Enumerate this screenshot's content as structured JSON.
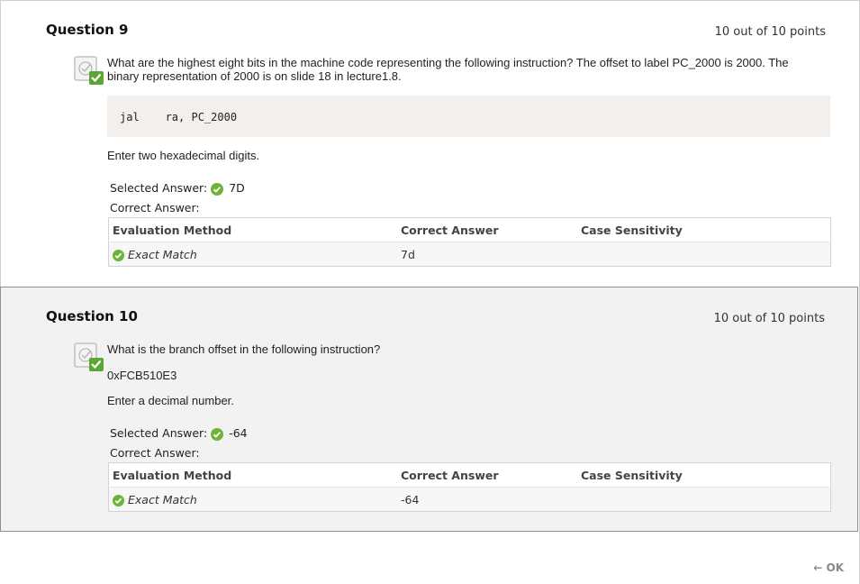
{
  "labels": {
    "selected_answer": "Selected Answer:",
    "correct_answer": "Correct Answer:",
    "col_method": "Evaluation Method",
    "col_correct": "Correct Answer",
    "col_case": "Case Sensitivity"
  },
  "questions": [
    {
      "title": "Question 9",
      "points": "10 out of 10 points",
      "text": "What are the highest eight bits in the machine code representing the following instruction? The offset to label PC_2000 is 2000. The binary representation of 2000 is on slide 18 in lecture1.8.",
      "code": "jal    ra, PC_2000",
      "instruction": "Enter two hexadecimal digits.",
      "selected_answer": "7D",
      "eval_method": "Exact Match",
      "correct_value": "7d",
      "case_sensitivity": ""
    },
    {
      "title": "Question 10",
      "points": "10 out of 10 points",
      "text": "What is the branch offset in the following instruction?",
      "code": "0xFCB510E3",
      "instruction": "Enter a decimal number.",
      "selected_answer": "-64",
      "eval_method": "Exact Match",
      "correct_value": "-64",
      "case_sensitivity": ""
    }
  ],
  "footer": {
    "ok_label": "← OK"
  },
  "colors": {
    "check_green": "#6fb33a",
    "card_grey": "#f2f2f2"
  },
  "icons": {
    "status": "correct-checkmark-icon",
    "answer": "green-check-icon"
  }
}
